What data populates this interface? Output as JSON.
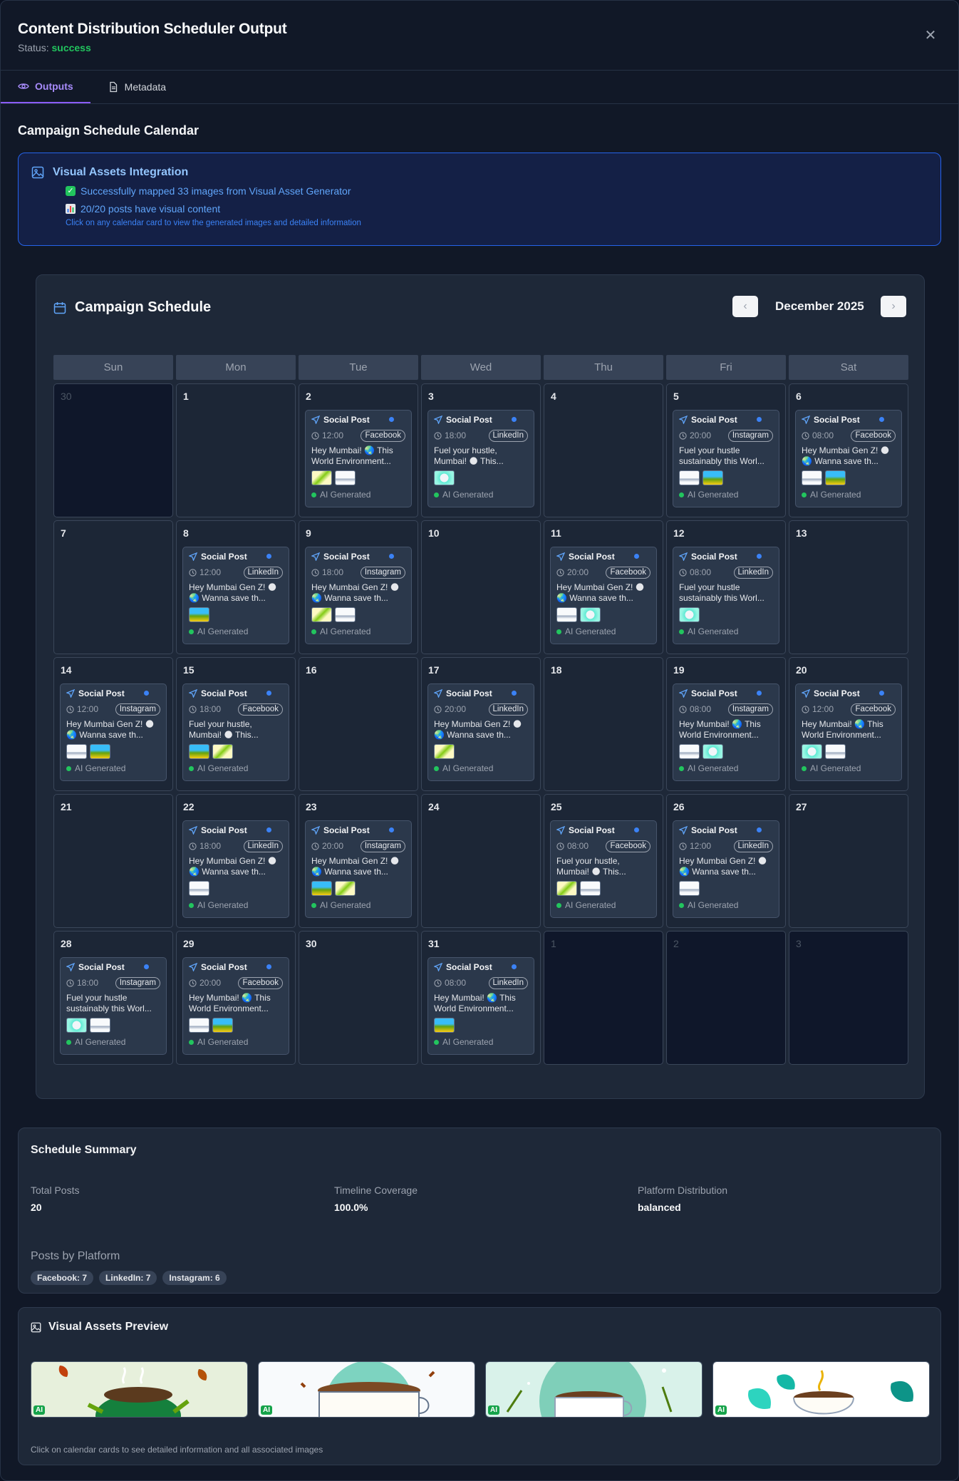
{
  "header": {
    "title": "Content Distribution Scheduler Output",
    "status_label": "Status:",
    "status_value": "success",
    "status_color": "#22c55e"
  },
  "tabs": [
    {
      "label": "Outputs",
      "icon": "eye-icon",
      "active": true
    },
    {
      "label": "Metadata",
      "icon": "document-icon",
      "active": false
    }
  ],
  "section_title": "Campaign Schedule Calendar",
  "visual_assets": {
    "title": "Visual Assets Integration",
    "line1": "Successfully mapped 33 images from Visual Asset Generator",
    "line2": "20/20 posts have visual content",
    "hint": "Click on any calendar card to view the generated images and detailed information"
  },
  "calendar": {
    "title": "Campaign Schedule",
    "month": "December 2025",
    "prev_label": "‹",
    "next_label": "›",
    "weekdays": [
      "Sun",
      "Mon",
      "Tue",
      "Wed",
      "Thu",
      "Fri",
      "Sat"
    ],
    "post_type_label": "Social Post",
    "ai_label": "AI Generated",
    "cells": [
      {
        "day": "30",
        "muted": true
      },
      {
        "day": "1"
      },
      {
        "day": "2",
        "post": {
          "time": "12:00",
          "platform": "Facebook",
          "text": "Hey Mumbai! 🌏 This World Environment...",
          "thumbs": [
            "a",
            "b"
          ]
        }
      },
      {
        "day": "3",
        "post": {
          "time": "18:00",
          "platform": "LinkedIn",
          "text": "Fuel your hustle, Mumbai! 🌑 This...",
          "thumbs": [
            "d"
          ]
        }
      },
      {
        "day": "4"
      },
      {
        "day": "5",
        "post": {
          "time": "20:00",
          "platform": "Instagram",
          "text": "Fuel your hustle sustainably this Worl...",
          "thumbs": [
            "b",
            "c"
          ]
        }
      },
      {
        "day": "6",
        "post": {
          "time": "08:00",
          "platform": "Facebook",
          "text": "Hey Mumbai Gen Z! 🌑 🌏 Wanna save th...",
          "thumbs": [
            "b",
            "c"
          ]
        }
      },
      {
        "day": "7"
      },
      {
        "day": "8",
        "post": {
          "time": "12:00",
          "platform": "LinkedIn",
          "text": "Hey Mumbai Gen Z! 🌑 🌏 Wanna save th...",
          "thumbs": [
            "c"
          ]
        }
      },
      {
        "day": "9",
        "post": {
          "time": "18:00",
          "platform": "Instagram",
          "text": "Hey Mumbai Gen Z! 🌑 🌏 Wanna save th...",
          "thumbs": [
            "a",
            "b"
          ]
        }
      },
      {
        "day": "10"
      },
      {
        "day": "11",
        "post": {
          "time": "20:00",
          "platform": "Facebook",
          "text": "Hey Mumbai Gen Z! 🌑 🌏 Wanna save th...",
          "thumbs": [
            "b",
            "d"
          ]
        }
      },
      {
        "day": "12",
        "post": {
          "time": "08:00",
          "platform": "LinkedIn",
          "text": "Fuel your hustle sustainably this Worl...",
          "thumbs": [
            "d"
          ]
        }
      },
      {
        "day": "13"
      },
      {
        "day": "14",
        "post": {
          "time": "12:00",
          "platform": "Instagram",
          "text": "Hey Mumbai Gen Z! 🌑 🌏 Wanna save th...",
          "thumbs": [
            "b",
            "c"
          ]
        }
      },
      {
        "day": "15",
        "post": {
          "time": "18:00",
          "platform": "Facebook",
          "text": "Fuel your hustle, Mumbai! 🌑 This...",
          "thumbs": [
            "c",
            "a"
          ]
        }
      },
      {
        "day": "16"
      },
      {
        "day": "17",
        "post": {
          "time": "20:00",
          "platform": "LinkedIn",
          "text": "Hey Mumbai Gen Z! 🌑 🌏 Wanna save th...",
          "thumbs": [
            "a"
          ]
        }
      },
      {
        "day": "18"
      },
      {
        "day": "19",
        "post": {
          "time": "08:00",
          "platform": "Instagram",
          "text": "Hey Mumbai! 🌏 This World Environment...",
          "thumbs": [
            "b",
            "d"
          ]
        }
      },
      {
        "day": "20",
        "post": {
          "time": "12:00",
          "platform": "Facebook",
          "text": "Hey Mumbai! 🌏 This World Environment...",
          "thumbs": [
            "d",
            "b"
          ]
        }
      },
      {
        "day": "21"
      },
      {
        "day": "22",
        "post": {
          "time": "18:00",
          "platform": "LinkedIn",
          "text": "Hey Mumbai Gen Z! 🌑 🌏 Wanna save th...",
          "thumbs": [
            "b"
          ]
        }
      },
      {
        "day": "23",
        "post": {
          "time": "20:00",
          "platform": "Instagram",
          "text": "Hey Mumbai Gen Z! 🌑 🌏 Wanna save th...",
          "thumbs": [
            "c",
            "a"
          ]
        }
      },
      {
        "day": "24"
      },
      {
        "day": "25",
        "post": {
          "time": "08:00",
          "platform": "Facebook",
          "text": "Fuel your hustle, Mumbai! 🌑 This...",
          "thumbs": [
            "a",
            "b"
          ]
        }
      },
      {
        "day": "26",
        "post": {
          "time": "12:00",
          "platform": "LinkedIn",
          "text": "Hey Mumbai Gen Z! 🌑 🌏 Wanna save th...",
          "thumbs": [
            "b"
          ]
        }
      },
      {
        "day": "27"
      },
      {
        "day": "28",
        "post": {
          "time": "18:00",
          "platform": "Instagram",
          "text": "Fuel your hustle sustainably this Worl...",
          "thumbs": [
            "d",
            "b"
          ]
        }
      },
      {
        "day": "29",
        "post": {
          "time": "20:00",
          "platform": "Facebook",
          "text": "Hey Mumbai! 🌏 This World Environment...",
          "thumbs": [
            "b",
            "c"
          ]
        }
      },
      {
        "day": "30"
      },
      {
        "day": "31",
        "post": {
          "time": "08:00",
          "platform": "LinkedIn",
          "text": "Hey Mumbai! 🌏 This World Environment...",
          "thumbs": [
            "c"
          ]
        }
      },
      {
        "day": "1",
        "muted": true
      },
      {
        "day": "2",
        "muted": true
      },
      {
        "day": "3",
        "muted": true
      }
    ]
  },
  "summary": {
    "title": "Schedule Summary",
    "stats": [
      {
        "label": "Total Posts",
        "value": "20"
      },
      {
        "label": "Timeline Coverage",
        "value": "100.0%"
      },
      {
        "label": "Platform Distribution",
        "value": "balanced"
      }
    ],
    "platform_title": "Posts by Platform",
    "chips": [
      "Facebook: 7",
      "LinkedIn: 7",
      "Instagram: 6"
    ]
  },
  "preview": {
    "title": "Visual Assets Preview",
    "ai_tag": "AI",
    "footer": "Click on calendar cards to see detailed information and all associated images"
  }
}
